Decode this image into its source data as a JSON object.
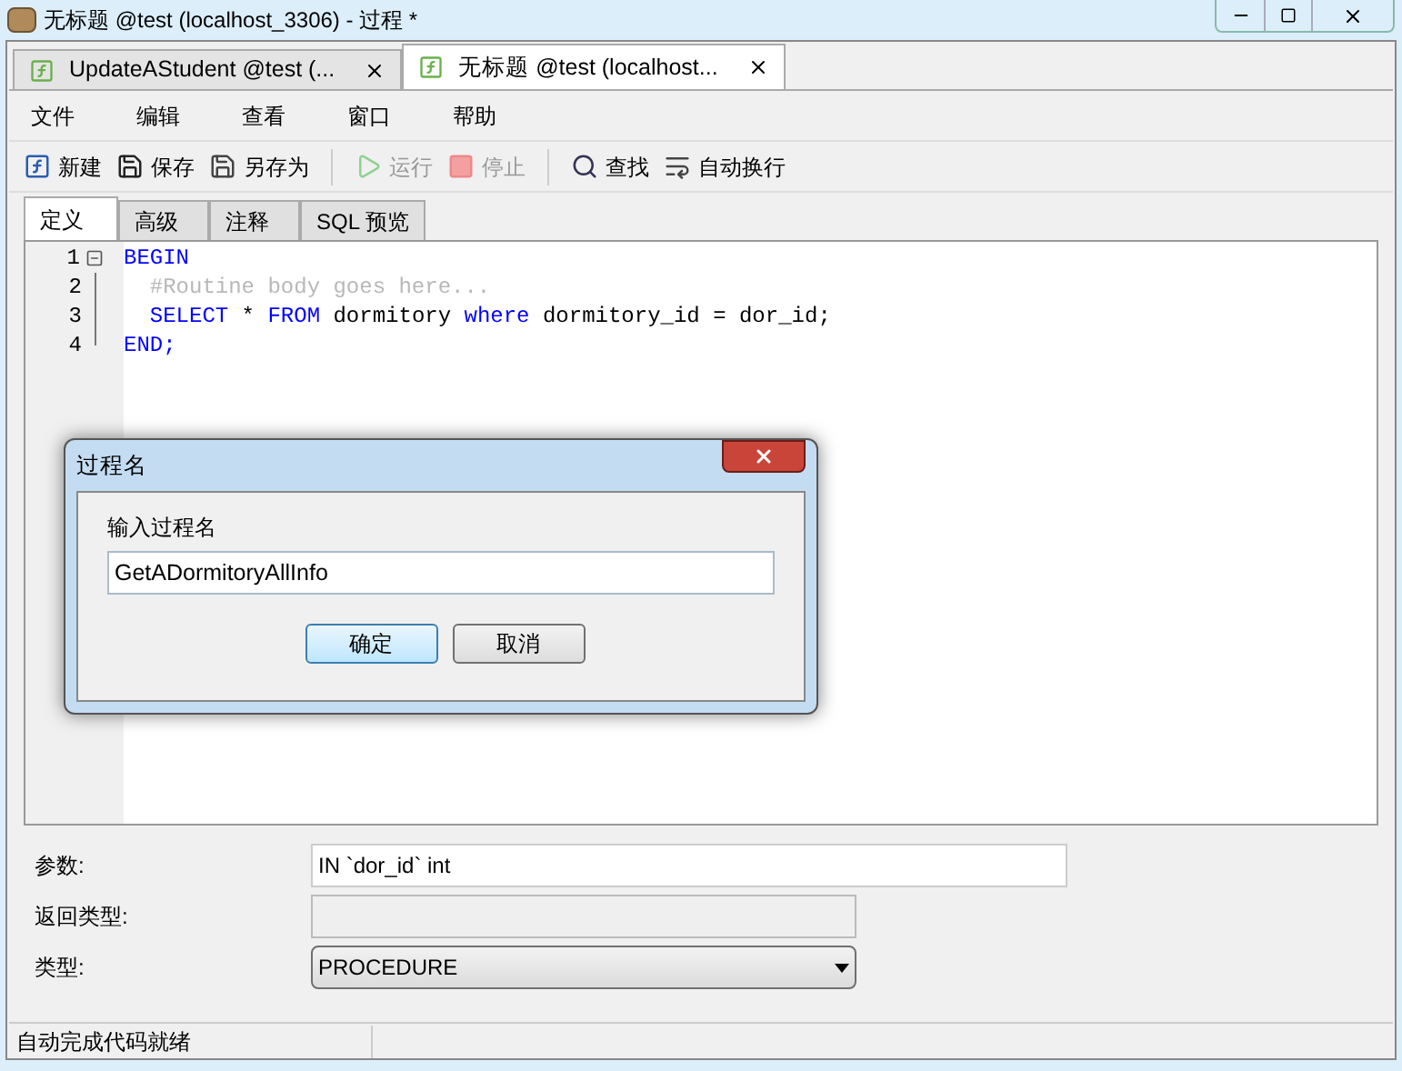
{
  "window": {
    "title": "无标题 @test (localhost_3306) - 过程 *"
  },
  "doc_tabs": [
    {
      "label": "UpdateAStudent @test (...",
      "selected": false
    },
    {
      "label": "无标题 @test (localhost...",
      "selected": true
    }
  ],
  "menu": [
    "文件",
    "编辑",
    "查看",
    "窗口",
    "帮助"
  ],
  "toolbar": [
    {
      "label": "新建",
      "kind": "new",
      "disabled": false
    },
    {
      "label": "保存",
      "kind": "save",
      "disabled": false
    },
    {
      "label": "另存为",
      "kind": "saveas",
      "disabled": false
    },
    {
      "label": "运行",
      "kind": "run",
      "disabled": true
    },
    {
      "label": "停止",
      "kind": "stop",
      "disabled": true
    },
    {
      "label": "查找",
      "kind": "find",
      "disabled": false
    },
    {
      "label": "自动换行",
      "kind": "wrap",
      "disabled": false
    }
  ],
  "sub_tabs": [
    {
      "label": "定义",
      "selected": true
    },
    {
      "label": "高级",
      "selected": false
    },
    {
      "label": "注释",
      "selected": false
    },
    {
      "label": "SQL 预览",
      "selected": false
    }
  ],
  "editor": {
    "lines": [
      {
        "number": "1",
        "tokens": [
          {
            "text": "BEGIN",
            "kind": "keyword"
          }
        ]
      },
      {
        "number": "2",
        "tokens": [
          {
            "text": "  #Routine body goes here...",
            "kind": "comment"
          }
        ]
      },
      {
        "number": "3",
        "tokens": [
          {
            "text": "  SELECT",
            "kind": "keyword"
          },
          {
            "text": " * ",
            "kind": "plain"
          },
          {
            "text": "FROM",
            "kind": "keyword"
          },
          {
            "text": " dormitory ",
            "kind": "plain"
          },
          {
            "text": "where",
            "kind": "keyword"
          },
          {
            "text": " dormitory_id = dor_id;",
            "kind": "plain"
          }
        ]
      },
      {
        "number": "4",
        "tokens": [
          {
            "text": "END;",
            "kind": "keyword"
          }
        ]
      }
    ]
  },
  "fields": [
    {
      "label": "参数:",
      "value": "IN `dor_id` int",
      "kind": "text"
    },
    {
      "label": "返回类型:",
      "kind": "disabled"
    },
    {
      "label": "类型:",
      "value": "PROCEDURE",
      "kind": "select"
    }
  ],
  "status_bar": {
    "text": "自动完成代码就绪"
  },
  "dialog": {
    "title": "过程名",
    "label": "输入过程名",
    "value": "GetADormitoryAllInfo",
    "buttons": [
      {
        "label": "确定",
        "selected": true
      },
      {
        "label": "取消",
        "selected": false
      }
    ]
  }
}
